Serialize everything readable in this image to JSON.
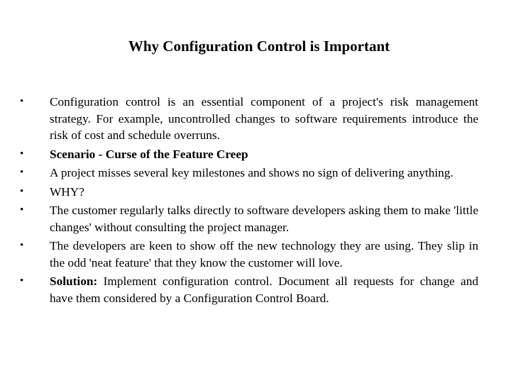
{
  "title": "Why Configuration Control is Important",
  "bullets": [
    {
      "bold": "",
      "text": "Configuration control is an essential component of a project's risk management strategy. For example, uncontrolled changes to software requirements introduce the risk of cost and schedule overruns."
    },
    {
      "bold": "Scenario - Curse of the Feature Creep",
      "text": ""
    },
    {
      "bold": "",
      "text": "A project misses several key milestones and shows no sign of delivering anything."
    },
    {
      "bold": "",
      "text": "WHY?"
    },
    {
      "bold": "",
      "text": "The customer regularly talks directly to software developers asking them to make 'little changes' without consulting the project manager."
    },
    {
      "bold": "",
      "text": "The developers are keen to show off the new technology they are using. They slip in the odd 'neat feature' that they know the customer will love."
    },
    {
      "bold": "Solution:",
      "text": " Implement configuration control. Document all requests for change and have them considered by a Configuration Control Board."
    }
  ],
  "bullet_glyph": "•"
}
